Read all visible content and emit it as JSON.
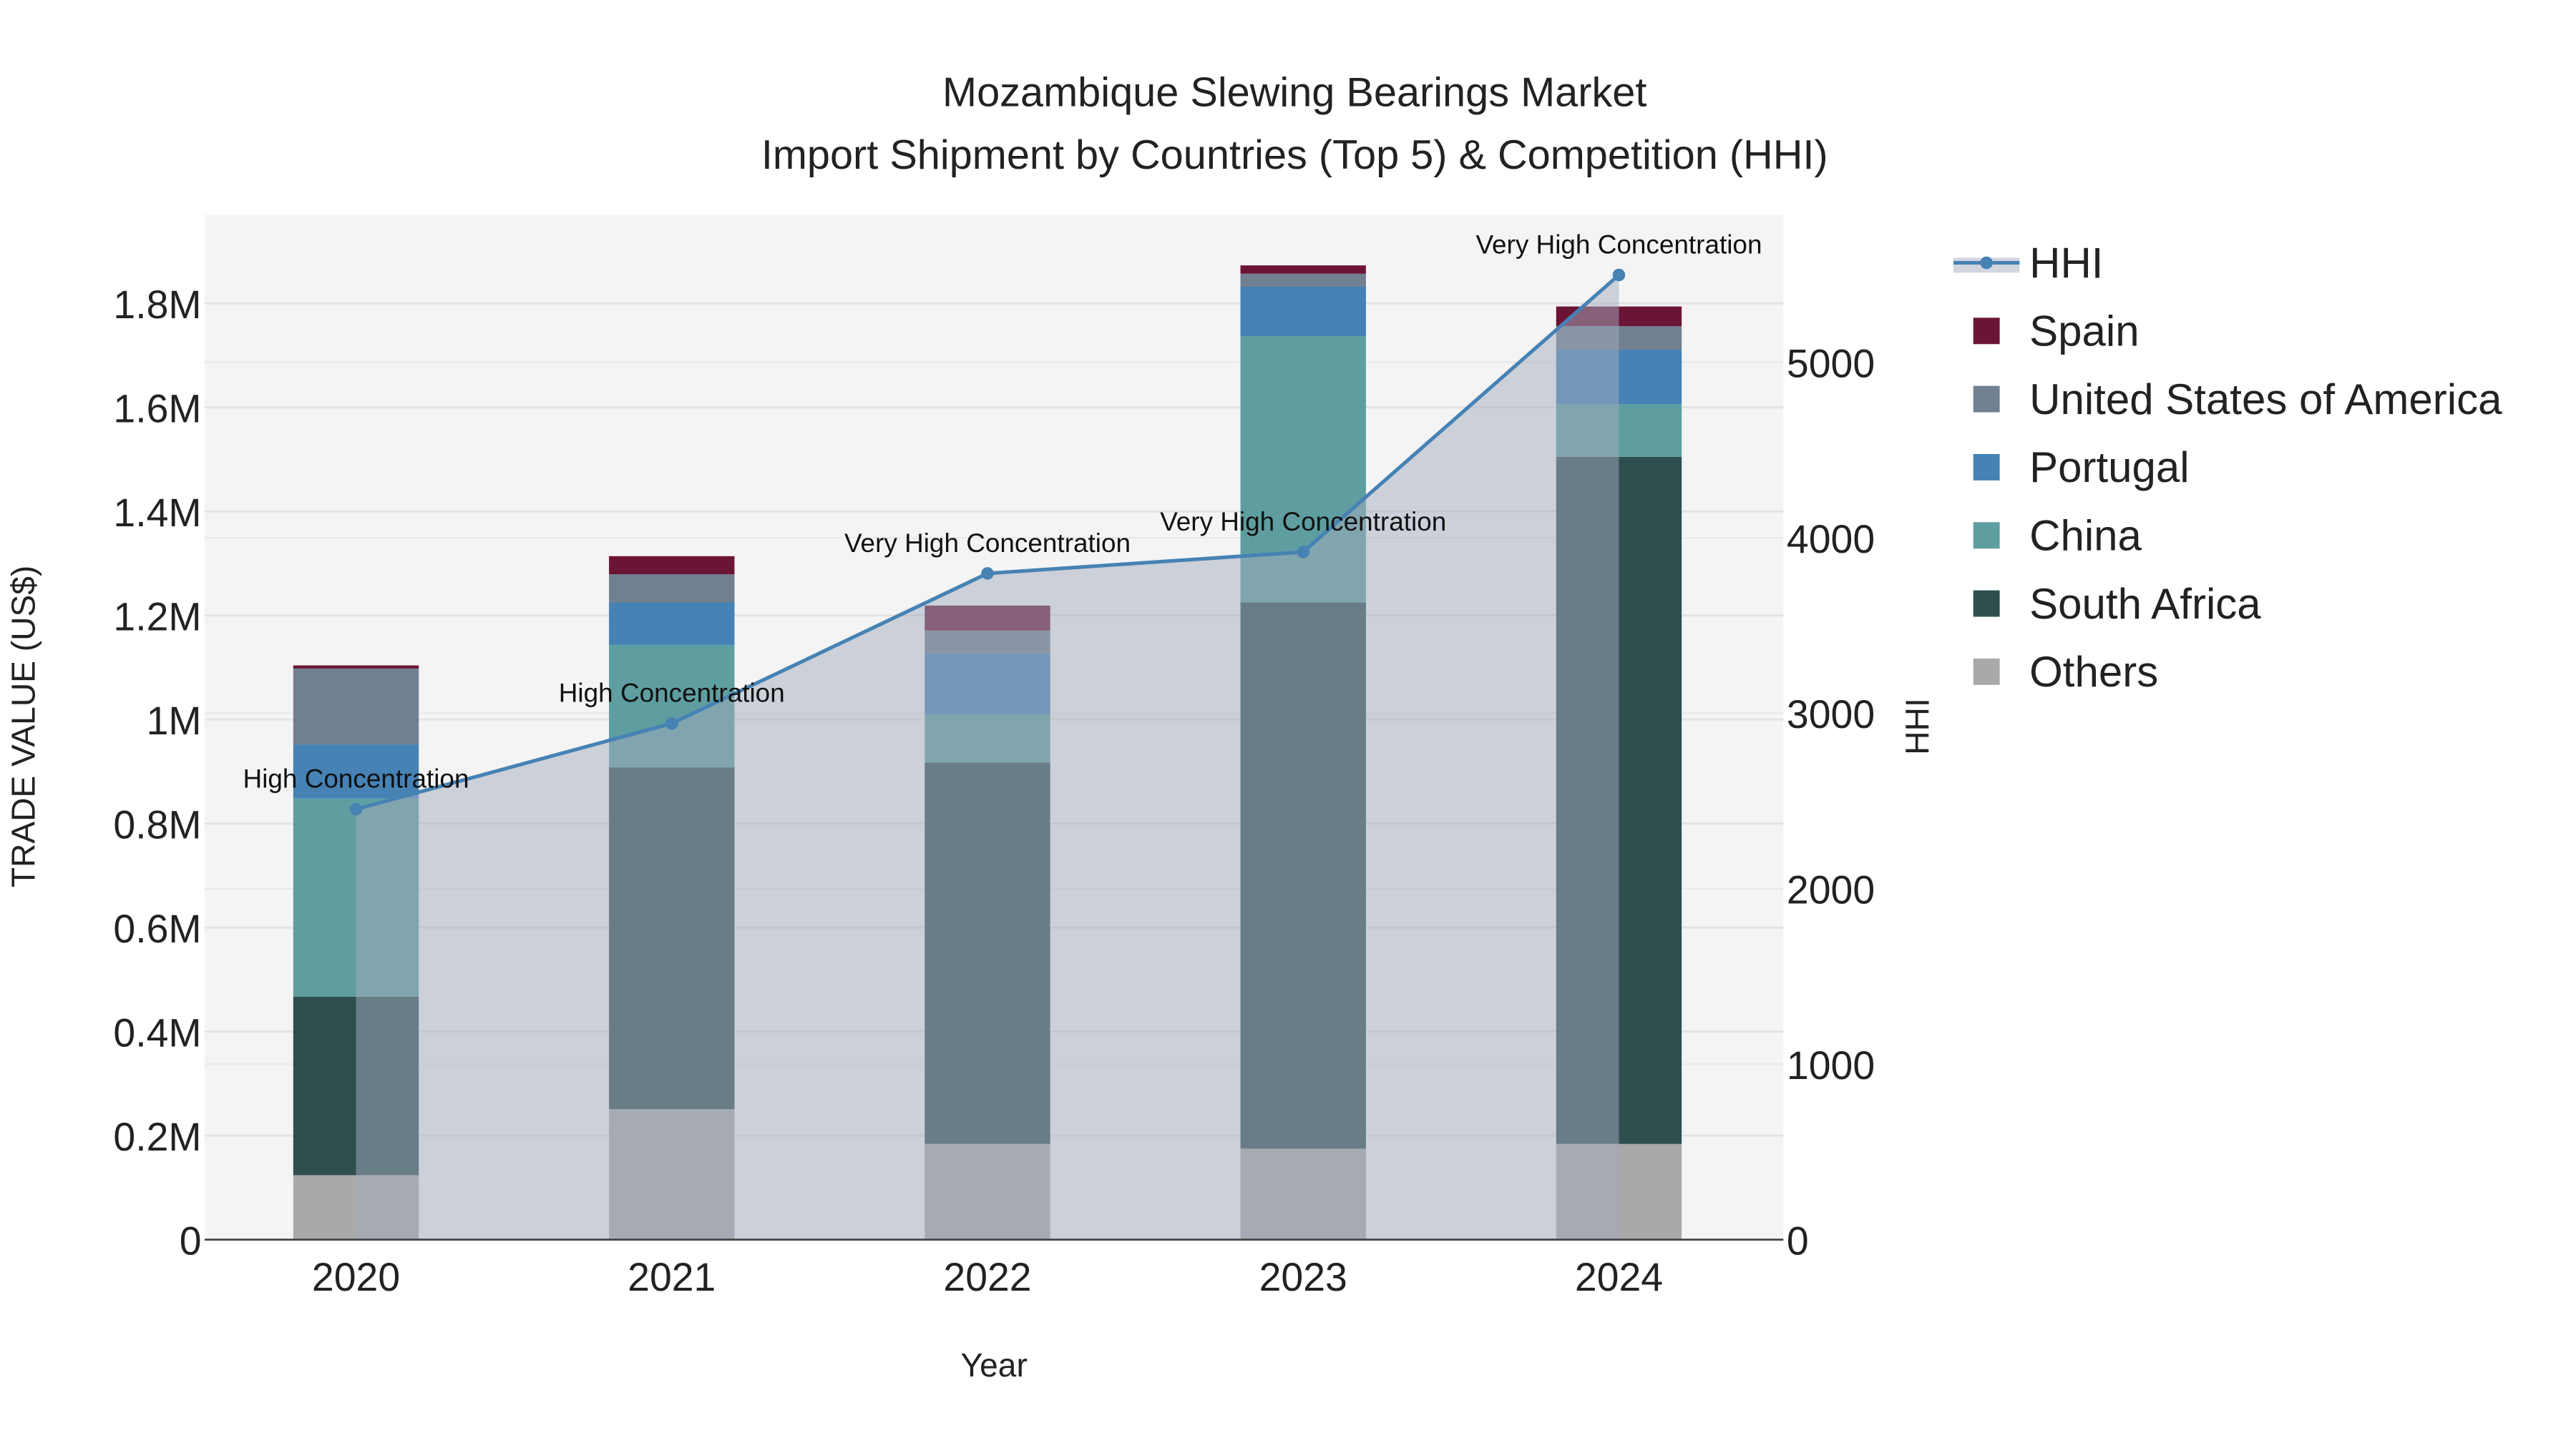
{
  "chart_data": {
    "type": "bar",
    "stacked": true,
    "title": "Mozambique Slewing Bearings Market",
    "subtitle": "Import Shipment by Countries (Top 5) & Competition (HHI)",
    "xlabel": "Year",
    "ylabel": "TRADE VALUE (US$)",
    "y2label": "HHI",
    "categories": [
      "2020",
      "2021",
      "2022",
      "2023",
      "2024"
    ],
    "ylim": [
      0,
      1970000
    ],
    "y2lim": [
      0,
      5840
    ],
    "yticks": [
      0,
      200000,
      400000,
      600000,
      800000,
      1000000,
      1200000,
      1400000,
      1600000,
      1800000
    ],
    "ytick_labels": [
      "0",
      "0.2M",
      "0.4M",
      "0.6M",
      "0.8M",
      "1M",
      "1.2M",
      "1.4M",
      "1.6M",
      "1.8M"
    ],
    "y2ticks": [
      0,
      1000,
      2000,
      3000,
      4000,
      5000
    ],
    "y2tick_labels": [
      "0",
      "1000",
      "2000",
      "3000",
      "4000",
      "5000"
    ],
    "grid": true,
    "legend_position": "right",
    "series": [
      {
        "name": "Others",
        "color": "#a9a9a9",
        "values": [
          124000,
          251000,
          184000,
          175000,
          184000
        ]
      },
      {
        "name": "South Africa",
        "color": "#2f4f4f",
        "values": [
          343000,
          657000,
          733000,
          1050000,
          1321000
        ]
      },
      {
        "name": "China",
        "color": "#5f9ea0",
        "values": [
          381000,
          235000,
          93000,
          512000,
          101000
        ]
      },
      {
        "name": "Portugal",
        "color": "#4682b4",
        "values": [
          104000,
          82000,
          117000,
          95000,
          105000
        ]
      },
      {
        "name": "United States of America",
        "color": "#708090",
        "values": [
          146000,
          54000,
          44000,
          25000,
          45000
        ]
      },
      {
        "name": "Spain",
        "color": "#6b1536",
        "values": [
          6000,
          35000,
          48000,
          16000,
          38000
        ]
      }
    ],
    "line": {
      "name": "HHI",
      "color": "#4682b4",
      "axis": "right",
      "values": [
        2453,
        2942,
        3797,
        3919,
        5498
      ],
      "annotations": [
        "High Concentration",
        "High Concentration",
        "Very High Concentration",
        "Very High Concentration",
        "Very High Concentration"
      ]
    },
    "legend": [
      "HHI",
      "Spain",
      "United States of America",
      "Portugal",
      "China",
      "South Africa",
      "Others"
    ]
  }
}
